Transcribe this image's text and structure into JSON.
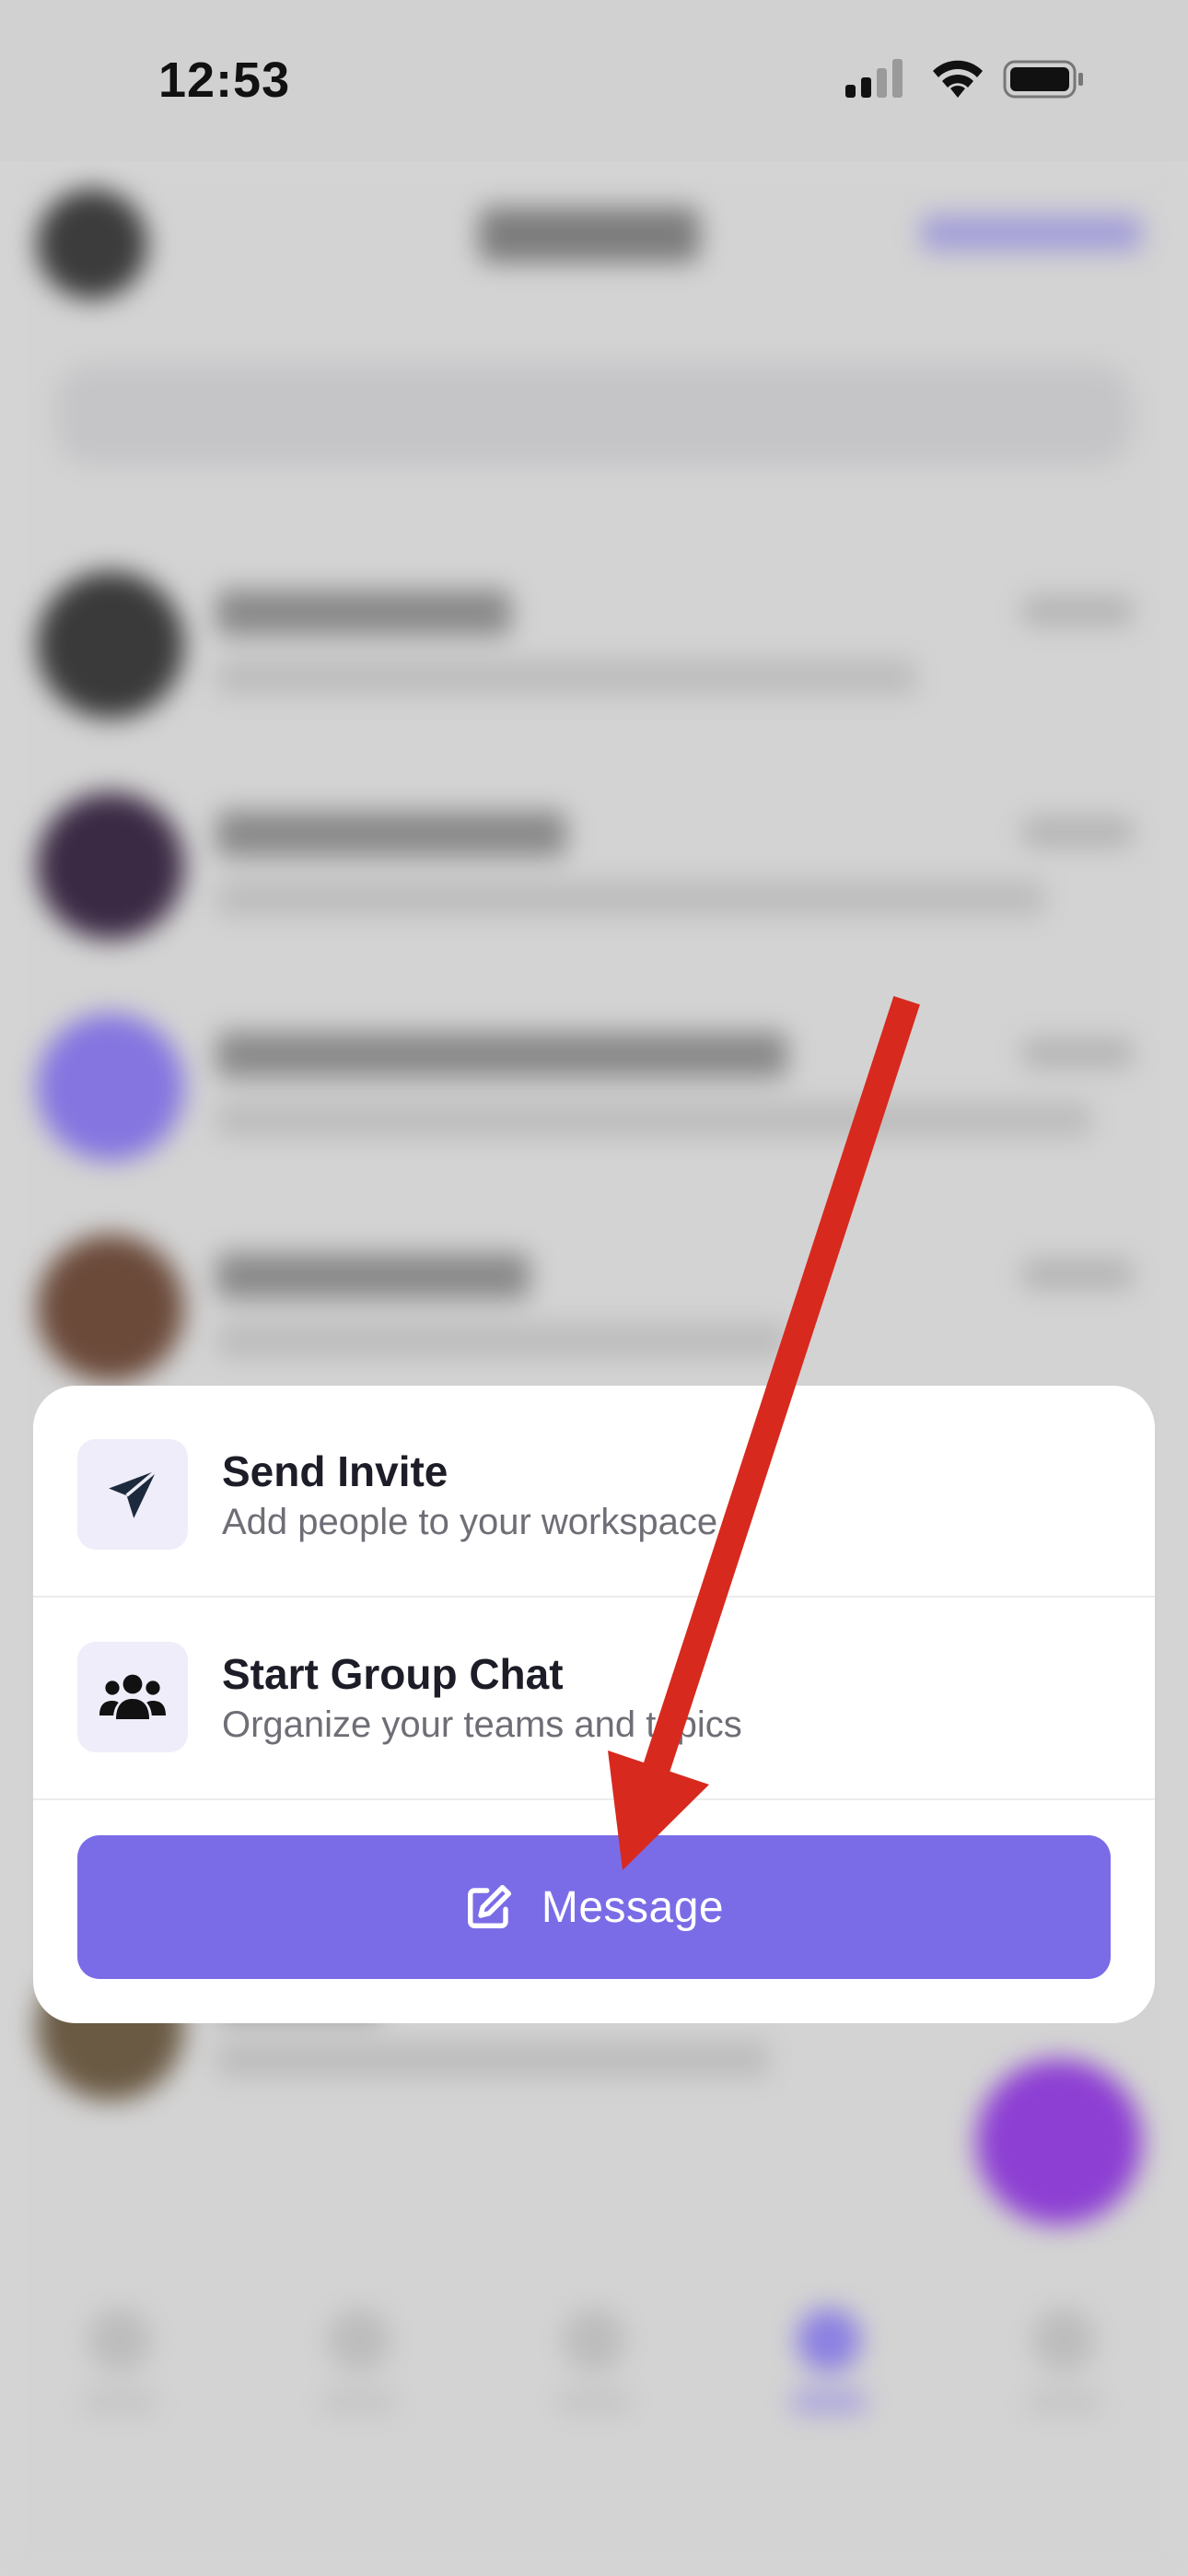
{
  "status_bar": {
    "time": "12:53",
    "icons": [
      "cellular-signal-icon",
      "wifi-icon",
      "battery-icon"
    ]
  },
  "action_sheet": {
    "items": [
      {
        "icon": "paper-plane-icon",
        "title": "Send Invite",
        "subtitle": "Add people to your workspace"
      },
      {
        "icon": "group-people-icon",
        "title": "Start Group Chat",
        "subtitle": "Organize your teams and topics"
      }
    ],
    "primary_button": {
      "icon": "compose-icon",
      "label": "Message"
    }
  },
  "colors": {
    "accent": "#7a6ce7",
    "icon_bg": "#eeedf9",
    "icon_fg": "#1d2a3d",
    "annotation_arrow": "#d8291e",
    "fab": "#8d3fd3"
  }
}
